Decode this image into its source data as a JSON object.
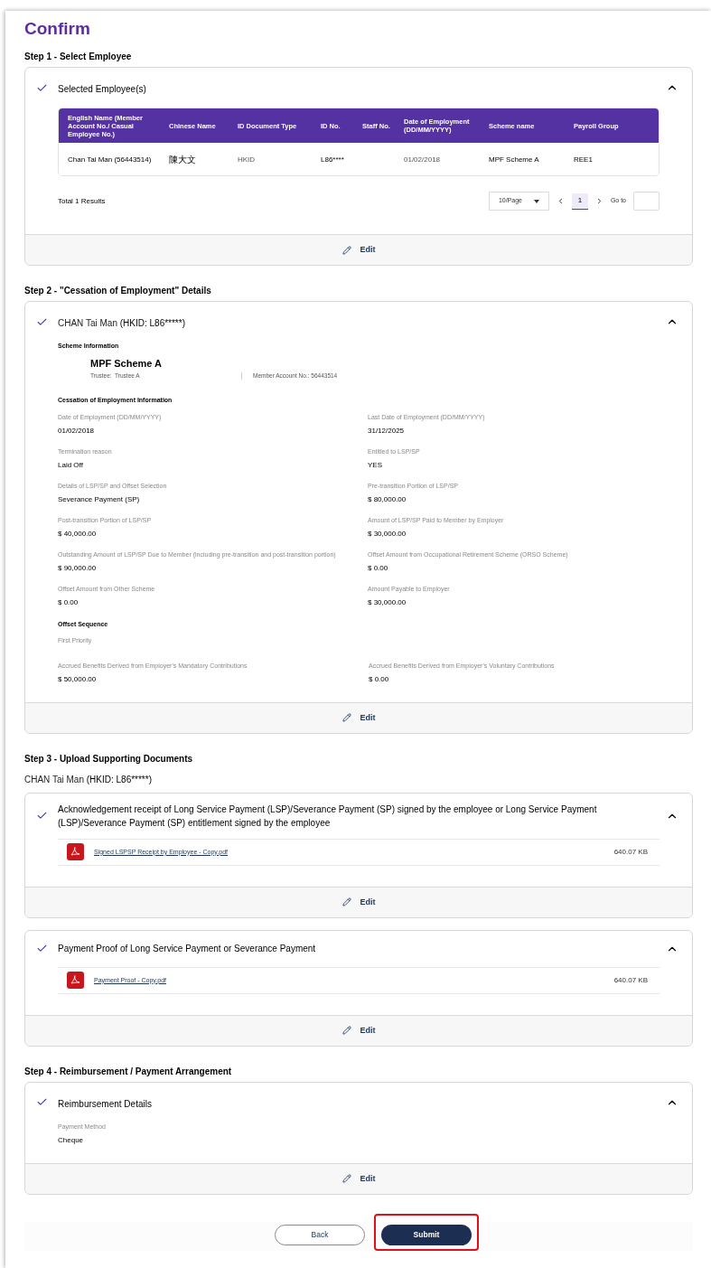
{
  "title": "Confirm",
  "step1": {
    "title": "Step 1 - Select Employee",
    "card": {
      "heading": "Selected Employee(s)",
      "checked": true,
      "expanded": true,
      "columns": [
        "English Name (Member Account No./ Casual Employee No.)",
        "Chinese Name",
        "ID Document Type",
        "ID No.",
        "Staff No.",
        "Date of Employment (DD/MM/YYYY)",
        "Scheme name",
        "Payroll Group"
      ],
      "rows": [
        [
          "Chan Tai Man (56443514)",
          "陳大文",
          "HKID",
          "L86****",
          "",
          "01/02/2018",
          "MPF Scheme A",
          "REE1"
        ]
      ],
      "total": "Total 1 Results",
      "page_size": "10/Page",
      "pages": [
        {
          "label": "1",
          "selected": true
        }
      ],
      "goto_label": "Go to",
      "edit": "Edit"
    }
  },
  "step2": {
    "title": "Step 2 - \"Cessation of Employment\" Details",
    "card": {
      "name": "CHAN Tai Man",
      "id": "(HKID: L86*****)",
      "checked": true,
      "expanded": true,
      "scheme_title": "Scheme Information",
      "scheme_name": "MPF Scheme A",
      "trustee": "Trustee:  Trustee A",
      "member_account": "Member Account No.: 56443514",
      "cessation_title": "Cessation of Employment Information",
      "fields": [
        {
          "label": "Date of Employment (DD/MM/YYYY)",
          "value": "01/02/2018"
        },
        {
          "label": "Last Date of Employment (DD/MM/YYYY)",
          "value": "31/12/2025"
        },
        {
          "label": "Termination reason",
          "value": "Laid Off"
        },
        {
          "label": "Entitled to LSP/SP",
          "value": "YES"
        },
        {
          "label": "Details of LSP/SP and Offset Selection",
          "value": "Severance Payment (SP)"
        },
        {
          "label": "Pre-transition Portion of LSP/SP",
          "value": "$ 80,000.00"
        },
        {
          "label": "Post-transition Portion of LSP/SP",
          "value": "$ 40,000.00"
        },
        {
          "label": "Amount of LSP/SP Paid to Member by Employer",
          "value": "$ 30,000.00"
        },
        {
          "label": "Outstanding Amount of LSP/SP Due to Member (including pre-transition and post-transition portion)",
          "value": "$ 90,000.00"
        },
        {
          "label": "Offset Amount from Occupational Retirement Scheme (ORSO Scheme)",
          "value": "$ 0.00"
        },
        {
          "label": "Offset Amount from Other Scheme",
          "value": "$ 0.00"
        },
        {
          "label": "Amount Payable to Employer",
          "value": "$ 30,000.00"
        }
      ],
      "offset_title": "Offset Sequence",
      "offset_priority": "First Priority",
      "offset_fields": [
        {
          "label": "Accrued Benefits Derived from Employer's Mandatory Contributions",
          "value": "$ 50,000.00"
        },
        {
          "label": "Accrued Benefits Derived from Employer's Voluntary Contributions",
          "value": "$ 0.00"
        }
      ],
      "edit": "Edit"
    }
  },
  "step3": {
    "title": "Step 3 - Upload Supporting Documents",
    "name": "CHAN Tai Man",
    "id": "(HKID: L86*****)",
    "cards": [
      {
        "heading": "Acknowledgement receipt of Long Service Payment (LSP)/Severance Payment (SP) signed by the employee or Long Service Payment (LSP)/Severance Payment (SP) entitlement signed by the employee",
        "checked": true,
        "expanded": true,
        "files": [
          {
            "name": "Signed LSPSP Receipt by Employee - Copy.pdf",
            "size": "640.07 KB"
          }
        ],
        "edit": "Edit"
      },
      {
        "heading": "Payment Proof of Long Service Payment or Severance Payment",
        "checked": true,
        "expanded": true,
        "files": [
          {
            "name": "Payment Proof - Copy.pdf",
            "size": "640.07 KB"
          }
        ],
        "edit": "Edit"
      }
    ]
  },
  "step4": {
    "title": "Step 4 - Reimbursement / Payment Arrangement",
    "card": {
      "heading": "Reimbursement Details",
      "checked": true,
      "expanded": true,
      "fields": [
        {
          "label": "Payment Method",
          "value": "Cheque"
        }
      ],
      "edit": "Edit"
    }
  },
  "actions": [
    {
      "label": "Back",
      "kind": "secondary",
      "highlighted": false
    },
    {
      "label": "Submit",
      "kind": "primary",
      "highlighted": true
    }
  ]
}
